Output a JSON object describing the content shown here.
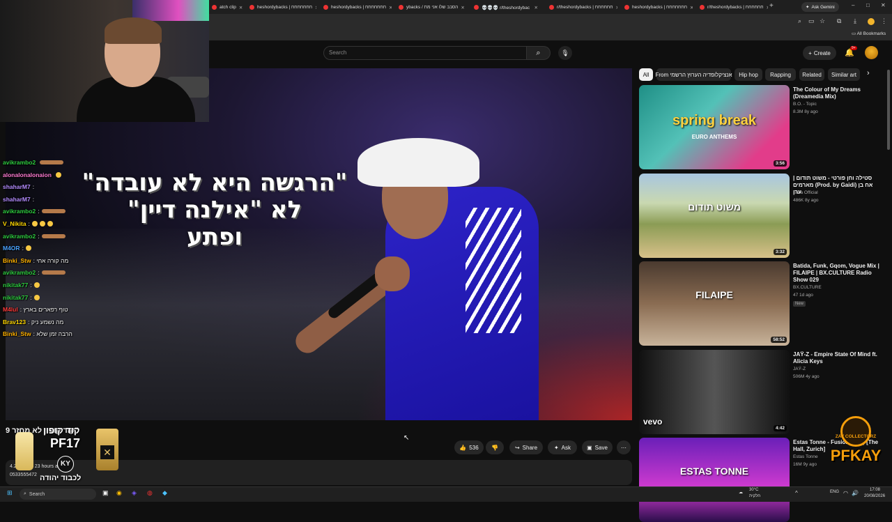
{
  "browser": {
    "tabs": [
      {
        "title": "atch clip"
      },
      {
        "title": "heshordybacks | חחחחחחח"
      },
      {
        "title": "heshordybacks | חחחחחחח"
      },
      {
        "title": "ybacks / הסבב שלו אני מת"
      },
      {
        "title": "💀💀💀 r/theshordybac"
      },
      {
        "title": "r/theshordybacks | חחחחחח"
      },
      {
        "title": "heshordybacks | חחחחחחח"
      },
      {
        "title": "r/theshordybacks | חחחחחח"
      }
    ],
    "new_tab": "+",
    "ask_gemini": "Ask Gemini",
    "all_bookmarks": "All Bookmarks"
  },
  "header": {
    "search_placeholder": "Search",
    "create_label": "Create",
    "notifications_badge": "9+"
  },
  "video": {
    "overlay_title_lines": [
      "\"הרגשה היא לא עובדה\"",
      "לא \"אילנה דיין\"",
      "ופתע"
    ],
    "title": "\"קוד קופון לא מחזר 9",
    "views_time": "4.2K views  23 hours ago",
    "phone": "0533555472",
    "like_count": "536",
    "share_label": "Share",
    "ask_label": "Ask",
    "save_label": "Save"
  },
  "chat": [
    {
      "user": "avikrambo2",
      "msg": "",
      "color": "#2ecc40",
      "emote": "wide"
    },
    {
      "user": "alonalonalonaion",
      "msg": "",
      "color": "#ff7bd2",
      "emote": "small"
    },
    {
      "user": "shaharM7",
      "msg": ":",
      "color": "#b48cff",
      "emote": ""
    },
    {
      "user": "shaharM7",
      "msg": ":",
      "color": "#b48cff",
      "emote": ""
    },
    {
      "user": "avikrambo2",
      "msg": ":",
      "color": "#2ecc40",
      "emote": "wide"
    },
    {
      "user": "V_Nikita",
      "msg": ":",
      "color": "#ffd700",
      "emote": "triple"
    },
    {
      "user": "avikrambo2",
      "msg": ":",
      "color": "#2ecc40",
      "emote": "wide"
    },
    {
      "user": "M4OR",
      "msg": ":",
      "color": "#4aa3ff",
      "emote": "small"
    },
    {
      "user": "Binki_Stw",
      "msg": ": מה קורה אחי",
      "color": "#ffb100",
      "emote": ""
    },
    {
      "user": "avikrambo2",
      "msg": ":",
      "color": "#2ecc40",
      "emote": "wide"
    },
    {
      "user": "nikitak77",
      "msg": ":",
      "color": "#2ecc40",
      "emote": "small"
    },
    {
      "user": "nikitak77",
      "msg": ":",
      "color": "#2ecc40",
      "emote": "small"
    },
    {
      "user": "M4lul",
      "msg": ": טוף רפארים בארץ",
      "color": "#ff3b3b",
      "emote": ""
    },
    {
      "user": "Brav123",
      "msg": ": מה נשמע ניק",
      "color": "#ffd700",
      "emote": ""
    },
    {
      "user": "Binki_Stw",
      "msg": ": הרבה זמן שלא",
      "color": "#ffb100",
      "emote": ""
    }
  ],
  "chips": [
    "All",
    "From אנציקלופדיה הערוץ הרשמי",
    "Hip hop",
    "Rapping",
    "Related",
    "Similar art"
  ],
  "recommendations": [
    {
      "title": "The Colour of My Dreams (Dreamedia Mix)",
      "channel": "B.O. - Topic",
      "meta": "8.3M  8y ago",
      "duration": "3:56",
      "thumb_text": "spring break",
      "thumb_sub": "EURO ANTHEMS"
    },
    {
      "title": "סטילה וחן פורטי - משוט תודום | מארמים (Prod. by Gaidi) אח בן ערן",
      "channel": "Stilla Official",
      "meta": "486K  8y ago",
      "duration": "3:32",
      "thumb_text": "משוט תודום",
      "thumb_sub": ""
    },
    {
      "title": "Batida, Funk, Gqom, Vogue Mix | FILAIPE | BX.CULTURE Radio Show 029",
      "channel": "BX.CULTURE",
      "meta": "47  1d ago",
      "duration": "58:52",
      "thumb_text": "FILAIPE",
      "thumb_sub": "",
      "badge": "New"
    },
    {
      "title": "JAŸ-Z - Empire State Of Mind ft. Alicia Keys",
      "channel": "JAŸ-Z",
      "meta": "506M  4y ago",
      "duration": "4:42",
      "thumb_text": "vevo",
      "thumb_sub": ""
    },
    {
      "title": "Estas Tonne - Fusion (Edit) [The Hall, Zurich]",
      "channel": "Estas Tonne",
      "meta": "16M  9y ago",
      "duration": "",
      "thumb_text": "ESTAS TONNE",
      "thumb_sub": ""
    }
  ],
  "overlays": {
    "coupon_line": "קוד קופון",
    "coupon_code": "PF17",
    "brand_initials": "KY",
    "perfume_caption": "לכבוד יהודה",
    "pfkay_logo": "PFKAY",
    "pfkay_top": "ZAY COLLECTORZ"
  },
  "taskbar": {
    "search_label": "Search",
    "weather_temp": "30°C",
    "weather_desc": "חלקית",
    "lang": "ENG",
    "time": "17:08",
    "date": "20/08/2026"
  }
}
